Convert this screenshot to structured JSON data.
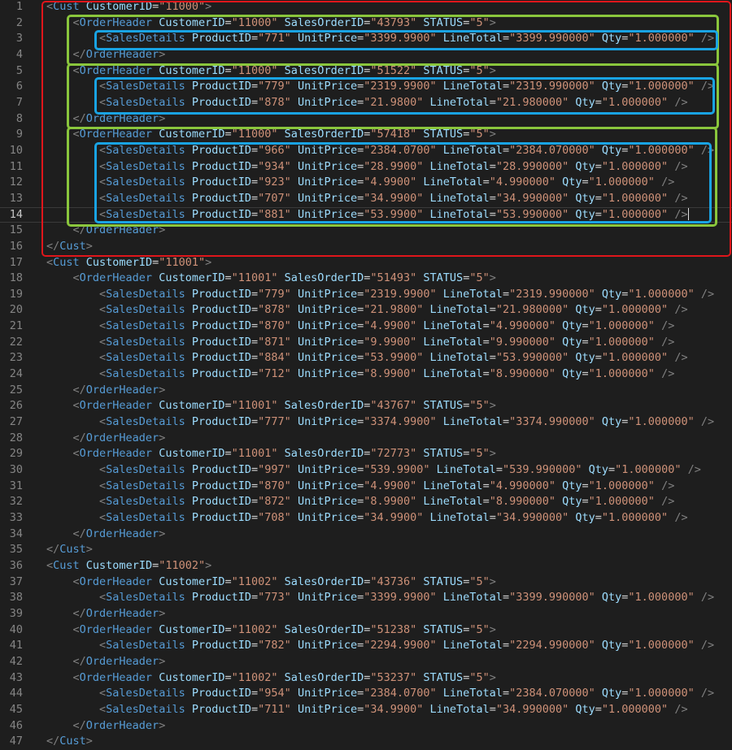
{
  "editor": {
    "current_line": 14,
    "colors": {
      "background": "#1e1e1e",
      "tag": "#569cd6",
      "attribute": "#9cdcfe",
      "string": "#ce9178",
      "punctuation": "#808080",
      "customer_box": "#e0161b",
      "order_box": "#8ac63c",
      "details_box": "#19a3e3"
    },
    "lines": [
      "<Cust CustomerID=\"11000\">",
      "    <OrderHeader CustomerID=\"11000\" SalesOrderID=\"43793\" STATUS=\"5\">",
      "        <SalesDetails ProductID=\"771\" UnitPrice=\"3399.9900\" LineTotal=\"3399.990000\" Qty=\"1.000000\" />",
      "    </OrderHeader>",
      "    <OrderHeader CustomerID=\"11000\" SalesOrderID=\"51522\" STATUS=\"5\">",
      "        <SalesDetails ProductID=\"779\" UnitPrice=\"2319.9900\" LineTotal=\"2319.990000\" Qty=\"1.000000\" />",
      "        <SalesDetails ProductID=\"878\" UnitPrice=\"21.9800\" LineTotal=\"21.980000\" Qty=\"1.000000\" />",
      "    </OrderHeader>",
      "    <OrderHeader CustomerID=\"11000\" SalesOrderID=\"57418\" STATUS=\"5\">",
      "        <SalesDetails ProductID=\"966\" UnitPrice=\"2384.0700\" LineTotal=\"2384.070000\" Qty=\"1.000000\" />",
      "        <SalesDetails ProductID=\"934\" UnitPrice=\"28.9900\" LineTotal=\"28.990000\" Qty=\"1.000000\" />",
      "        <SalesDetails ProductID=\"923\" UnitPrice=\"4.9900\" LineTotal=\"4.990000\" Qty=\"1.000000\" />",
      "        <SalesDetails ProductID=\"707\" UnitPrice=\"34.9900\" LineTotal=\"34.990000\" Qty=\"1.000000\" />",
      "        <SalesDetails ProductID=\"881\" UnitPrice=\"53.9900\" LineTotal=\"53.990000\" Qty=\"1.000000\" />",
      "    </OrderHeader>",
      "</Cust>",
      "<Cust CustomerID=\"11001\">",
      "    <OrderHeader CustomerID=\"11001\" SalesOrderID=\"51493\" STATUS=\"5\">",
      "        <SalesDetails ProductID=\"779\" UnitPrice=\"2319.9900\" LineTotal=\"2319.990000\" Qty=\"1.000000\" />",
      "        <SalesDetails ProductID=\"878\" UnitPrice=\"21.9800\" LineTotal=\"21.980000\" Qty=\"1.000000\" />",
      "        <SalesDetails ProductID=\"870\" UnitPrice=\"4.9900\" LineTotal=\"4.990000\" Qty=\"1.000000\" />",
      "        <SalesDetails ProductID=\"871\" UnitPrice=\"9.9900\" LineTotal=\"9.990000\" Qty=\"1.000000\" />",
      "        <SalesDetails ProductID=\"884\" UnitPrice=\"53.9900\" LineTotal=\"53.990000\" Qty=\"1.000000\" />",
      "        <SalesDetails ProductID=\"712\" UnitPrice=\"8.9900\" LineTotal=\"8.990000\" Qty=\"1.000000\" />",
      "    </OrderHeader>",
      "    <OrderHeader CustomerID=\"11001\" SalesOrderID=\"43767\" STATUS=\"5\">",
      "        <SalesDetails ProductID=\"777\" UnitPrice=\"3374.9900\" LineTotal=\"3374.990000\" Qty=\"1.000000\" />",
      "    </OrderHeader>",
      "    <OrderHeader CustomerID=\"11001\" SalesOrderID=\"72773\" STATUS=\"5\">",
      "        <SalesDetails ProductID=\"997\" UnitPrice=\"539.9900\" LineTotal=\"539.990000\" Qty=\"1.000000\" />",
      "        <SalesDetails ProductID=\"870\" UnitPrice=\"4.9900\" LineTotal=\"4.990000\" Qty=\"1.000000\" />",
      "        <SalesDetails ProductID=\"872\" UnitPrice=\"8.9900\" LineTotal=\"8.990000\" Qty=\"1.000000\" />",
      "        <SalesDetails ProductID=\"708\" UnitPrice=\"34.9900\" LineTotal=\"34.990000\" Qty=\"1.000000\" />",
      "    </OrderHeader>",
      "</Cust>",
      "<Cust CustomerID=\"11002\">",
      "    <OrderHeader CustomerID=\"11002\" SalesOrderID=\"43736\" STATUS=\"5\">",
      "        <SalesDetails ProductID=\"773\" UnitPrice=\"3399.9900\" LineTotal=\"3399.990000\" Qty=\"1.000000\" />",
      "    </OrderHeader>",
      "    <OrderHeader CustomerID=\"11002\" SalesOrderID=\"51238\" STATUS=\"5\">",
      "        <SalesDetails ProductID=\"782\" UnitPrice=\"2294.9900\" LineTotal=\"2294.990000\" Qty=\"1.000000\" />",
      "    </OrderHeader>",
      "    <OrderHeader CustomerID=\"11002\" SalesOrderID=\"53237\" STATUS=\"5\">",
      "        <SalesDetails ProductID=\"954\" UnitPrice=\"2384.0700\" LineTotal=\"2384.070000\" Qty=\"1.000000\" />",
      "        <SalesDetails ProductID=\"711\" UnitPrice=\"34.9900\" LineTotal=\"34.990000\" Qty=\"1.000000\" />",
      "    </OrderHeader>",
      "</Cust>"
    ]
  }
}
